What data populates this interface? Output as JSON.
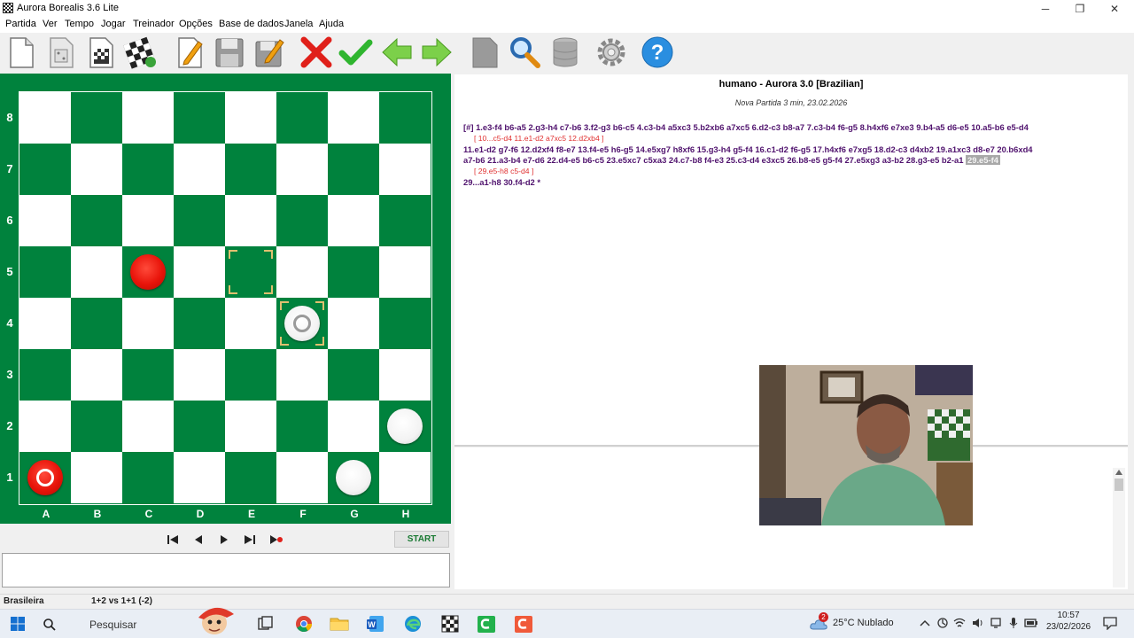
{
  "window": {
    "title": "Aurora Borealis 3.6 Lite",
    "controls": {
      "minimize": "─",
      "restore": "❐",
      "close": "✕"
    }
  },
  "menu": [
    "Partida",
    "Ver",
    "Tempo",
    "Jogar",
    "Treinador",
    "Opções",
    "Base de dados",
    "Janela",
    "Ajuda"
  ],
  "toolbar": {
    "icons": [
      "new-document-icon",
      "dice-icon",
      "board-icon",
      "checkered-board-refresh-icon",
      "edit-pencil-icon",
      "save-floppy-icon",
      "save-edit-icon",
      "cancel-x-icon",
      "confirm-check-icon",
      "arrow-left-icon",
      "arrow-right-icon",
      "tag-icon",
      "magnifier-icon",
      "database-icon",
      "settings-gear-icon",
      "help-icon"
    ]
  },
  "board": {
    "files": [
      "A",
      "B",
      "C",
      "D",
      "E",
      "F",
      "G",
      "H"
    ],
    "ranks": [
      "8",
      "7",
      "6",
      "5",
      "4",
      "3",
      "2",
      "1"
    ],
    "pieces": [
      {
        "square": "c5",
        "color": "red",
        "king": false
      },
      {
        "square": "a1",
        "color": "red",
        "king": true
      },
      {
        "square": "f4",
        "color": "white",
        "king": true
      },
      {
        "square": "h2",
        "color": "white",
        "king": false
      },
      {
        "square": "g1",
        "color": "white",
        "king": false
      }
    ],
    "highlight_squares": [
      "e5",
      "f4"
    ],
    "colors": {
      "dark": "#00823d",
      "light": "#ffffff",
      "red": "#e8140a"
    }
  },
  "navigation": {
    "buttons": [
      "first-move-icon",
      "prev-move-icon",
      "next-move-icon",
      "last-move-icon",
      "end-variation-icon"
    ],
    "start_label": "START"
  },
  "status": {
    "variant": "Brasileira",
    "material": "1+2 vs 1+1 (-2)"
  },
  "game": {
    "title": "humano - Aurora 3.0 [Brazilian]",
    "subtitle": "Nova Partida 3 min, 23.02.2026",
    "moves": [
      {
        "kind": "main",
        "text": "[#] 1.e3-f4 b6-a5 2.g3-h4 c7-b6 3.f2-g3 b6-c5 4.c3-b4 a5xc3 5.b2xb6 a7xc5 6.d2-c3 b8-a7 7.c3-b4 f6-g5 8.h4xf6 e7xe3 9.b4-a5 d6-e5 10.a5-b6 e5-d4"
      },
      {
        "kind": "var",
        "text": "[ 10...c5-d4 11.e1-d2 a7xc5 12.d2xb4 ]"
      },
      {
        "kind": "main",
        "text": "11.e1-d2 g7-f6 12.d2xf4 f8-e7 13.f4-e5 h6-g5 14.e5xg7 h8xf6 15.g3-h4 g5-f4 16.c1-d2 f6-g5 17.h4xf6 e7xg5 18.d2-c3 d4xb2 19.a1xc3 d8-e7 20.b6xd4"
      },
      {
        "kind": "main",
        "text": "a7-b6 21.a3-b4 e7-d6 22.d4-e5 b6-c5 23.e5xc7 c5xa3 24.c7-b8 f4-e3 25.c3-d4 e3xc5 26.b8-e5 g5-f4 27.e5xg3 a3-b2 28.g3-e5 b2-a1",
        "highlight": "29.e5-f4"
      },
      {
        "kind": "var",
        "text": "[ 29.e5-h8 c5-d4 ]"
      },
      {
        "kind": "main",
        "text": "29...a1-h8 30.f4-d2  *"
      }
    ]
  },
  "taskbar": {
    "search_placeholder": "Pesquisar",
    "weather": "25°C  Nublado",
    "weather_badge": "2",
    "time": "10:57",
    "date": "23/02/2026",
    "apps": [
      "start-icon",
      "search-icon",
      "mascot-icon",
      "task-view-icon",
      "chrome-icon",
      "file-explorer-icon",
      "word-icon",
      "edge-icon",
      "aurora-app-icon",
      "green-app-icon",
      "red-app-icon"
    ]
  }
}
